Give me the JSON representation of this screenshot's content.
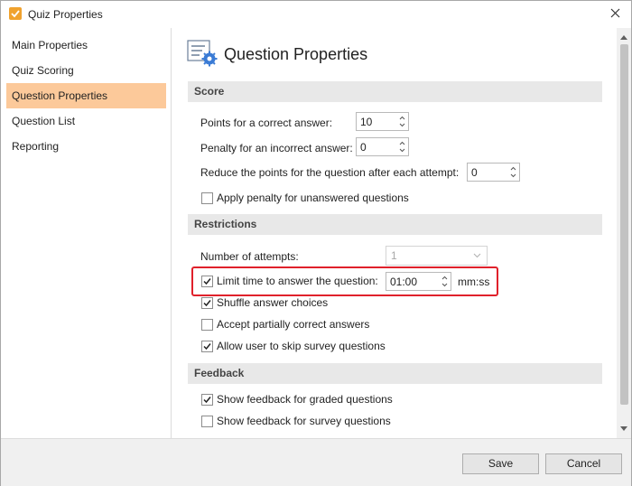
{
  "window": {
    "title": "Quiz Properties"
  },
  "sidebar": {
    "items": [
      {
        "label": "Main Properties"
      },
      {
        "label": "Quiz Scoring"
      },
      {
        "label": "Question Properties"
      },
      {
        "label": "Question List"
      },
      {
        "label": "Reporting"
      }
    ],
    "active_index": 2
  },
  "page": {
    "title": "Question Properties"
  },
  "score": {
    "header": "Score",
    "correct_label": "Points for a correct answer:",
    "correct_value": "10",
    "penalty_label": "Penalty for an incorrect answer:",
    "penalty_value": "0",
    "reduce_label": "Reduce the points for the question after each attempt:",
    "reduce_value": "0",
    "unanswered_label": "Apply penalty for unanswered questions",
    "unanswered_checked": false
  },
  "restrictions": {
    "header": "Restrictions",
    "attempts_label": "Number of attempts:",
    "attempts_value": "1",
    "limit_time_label": "Limit time to answer the question:",
    "limit_time_checked": true,
    "time_value": "01:00",
    "time_unit": "mm:ss",
    "shuffle_label": "Shuffle answer choices",
    "shuffle_checked": true,
    "partial_label": "Accept partially correct answers",
    "partial_checked": false,
    "skip_label": "Allow user to skip survey questions",
    "skip_checked": true
  },
  "feedback": {
    "header": "Feedback",
    "graded_label": "Show feedback for graded questions",
    "graded_checked": true,
    "survey_label": "Show feedback for survey questions",
    "survey_checked": false
  },
  "footer": {
    "save_label": "Save",
    "cancel_label": "Cancel"
  },
  "colors": {
    "active_nav": "#fcc99a",
    "highlight": "#e0212b",
    "app_icon": "#f0a22e"
  }
}
